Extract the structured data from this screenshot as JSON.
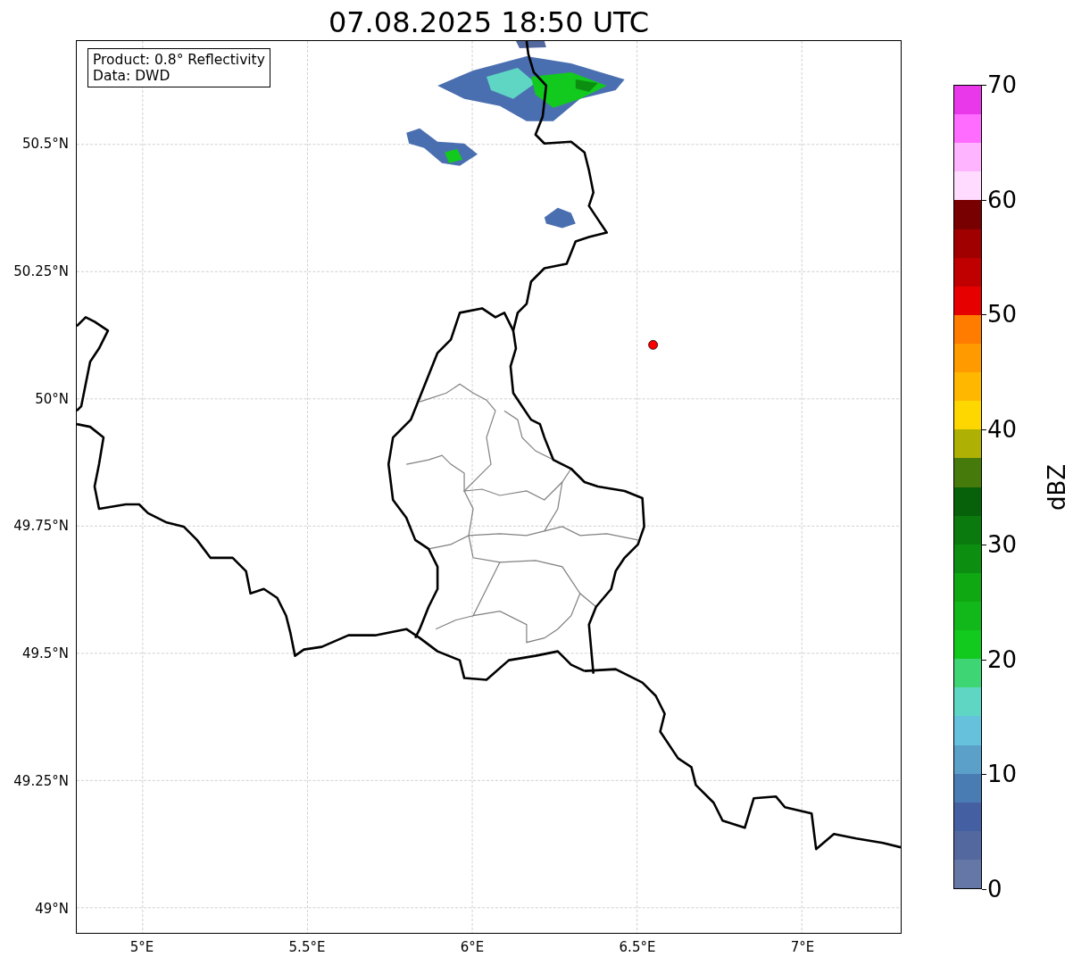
{
  "title": "07.08.2025 18:50 UTC",
  "info_box": {
    "lines": [
      "Product: 0.8° Reflectivity",
      "Data: DWD"
    ]
  },
  "y_axis": {
    "ticks": [
      "50.5°N",
      "50.25°N",
      "50°N",
      "49.75°N",
      "49.5°N",
      "49.25°N",
      "49°N"
    ]
  },
  "x_axis": {
    "ticks": [
      "5°E",
      "5.5°E",
      "6°E",
      "6.5°E",
      "7°E"
    ]
  },
  "colorbar": {
    "label": "dBZ",
    "ticks": [
      "70",
      "60",
      "50",
      "40",
      "30",
      "20",
      "10",
      "0"
    ],
    "bins": [
      {
        "color": "#e838ea"
      },
      {
        "color": "#ff6cff"
      },
      {
        "color": "#ffb4ff"
      },
      {
        "color": "#ffdcff"
      },
      {
        "color": "#780000"
      },
      {
        "color": "#a00000"
      },
      {
        "color": "#c00000"
      },
      {
        "color": "#e60000"
      },
      {
        "color": "#ff7c00"
      },
      {
        "color": "#ff9a00"
      },
      {
        "color": "#ffb700"
      },
      {
        "color": "#ffd700"
      },
      {
        "color": "#aeb004"
      },
      {
        "color": "#467a0a"
      },
      {
        "color": "#07600a"
      },
      {
        "color": "#0b7a0e"
      },
      {
        "color": "#0c8f10"
      },
      {
        "color": "#0fa712"
      },
      {
        "color": "#12b81a"
      },
      {
        "color": "#12c91e"
      },
      {
        "color": "#3ed675"
      },
      {
        "color": "#5fd6c4"
      },
      {
        "color": "#66c2dc"
      },
      {
        "color": "#5aa0c8"
      },
      {
        "color": "#4a7cb4"
      },
      {
        "color": "#4560a2"
      },
      {
        "color": "#5468a0"
      },
      {
        "color": "#6577a6"
      }
    ]
  }
}
